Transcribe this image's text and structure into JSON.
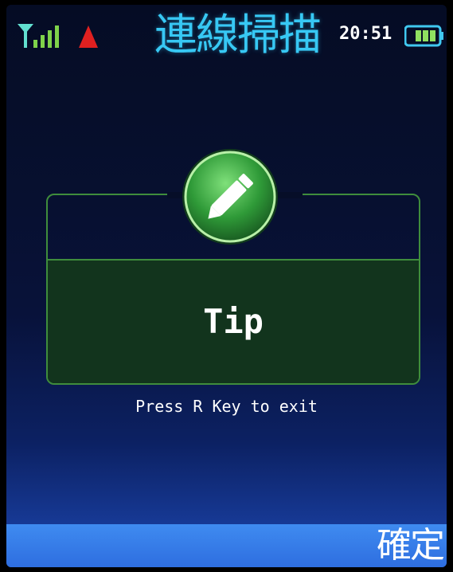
{
  "status_bar": {
    "title": "連線掃描",
    "time": "20:51",
    "signal_icon": "signal-strength-icon",
    "alert_icon": "red-triangle-icon",
    "battery_icon": "battery-icon",
    "battery_level_fraction": 0.75
  },
  "dialog": {
    "icon": "pencil-edit-icon",
    "title": "Tip",
    "hint": "Press R Key to exit"
  },
  "softkeys": {
    "right_label": "確定"
  },
  "colors": {
    "title_cyan": "#37c8f4",
    "dialog_border": "#3f8d3c",
    "dialog_fill": "#12341d",
    "softkey_blue": "#3f8bf0",
    "alert_red": "#e02020",
    "battery_green": "#8fe060"
  }
}
